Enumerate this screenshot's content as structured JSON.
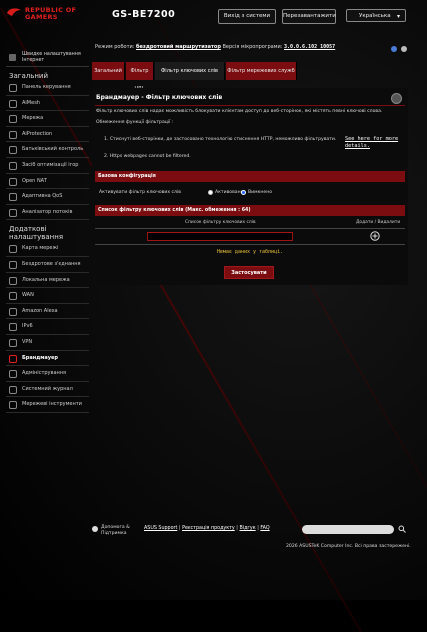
{
  "header": {
    "brand_line1": "REPUBLIC OF",
    "brand_line2": "GAMERS",
    "model": "GS-BE7200",
    "logout_label": "Вихід з системи",
    "reboot_label": "Перезавантажити",
    "language": "Українська"
  },
  "fwinfo": {
    "mode_label": "Режим роботи:",
    "mode_value": "бездротовий маршрутизатор",
    "version_label": "Версія мікропрограми:",
    "version_value": "3.0.0.6.102_10057"
  },
  "sidebar": {
    "quick_setup": "Швидке налаштування Інтернет",
    "general_title": "Загальний",
    "general_items": [
      {
        "label": "Панель керування",
        "icon": "dashboard-icon"
      },
      {
        "label": "AiMesh",
        "icon": "aimesh-icon"
      },
      {
        "label": "Мережа",
        "icon": "network-icon"
      },
      {
        "label": "AiProtection",
        "icon": "shield-icon"
      },
      {
        "label": "Батьківський контроль",
        "icon": "parental-icon"
      },
      {
        "label": "Засіб оптимізації ігор",
        "icon": "gamepad-icon"
      },
      {
        "label": "Open NAT",
        "icon": "nat-icon"
      },
      {
        "label": "Адаптивна QoS",
        "icon": "qos-icon"
      },
      {
        "label": "Аналізатор потоків",
        "icon": "traffic-icon"
      }
    ],
    "advanced_title": "Додаткові налаштування",
    "advanced_items": [
      {
        "label": "Карта мережі",
        "icon": "map-icon"
      },
      {
        "label": "Бездротове з'єднання",
        "icon": "wifi-icon"
      },
      {
        "label": "Локальна мережа",
        "icon": "lan-icon"
      },
      {
        "label": "WAN",
        "icon": "globe-icon"
      },
      {
        "label": "Amazon Alexa",
        "icon": "alexa-icon"
      },
      {
        "label": "IPv6",
        "icon": "ipv6-icon"
      },
      {
        "label": "VPN",
        "icon": "vpn-icon"
      },
      {
        "label": "Брандмауер",
        "icon": "firewall-icon",
        "active": true
      },
      {
        "label": "Адміністрування",
        "icon": "admin-icon"
      },
      {
        "label": "Системний журнал",
        "icon": "log-icon"
      },
      {
        "label": "Мережеві інструменти",
        "icon": "tools-icon"
      }
    ]
  },
  "tabs": [
    {
      "label": "Загальний"
    },
    {
      "label": "Фільтр URL"
    },
    {
      "label": "Фільтр ключових слів",
      "active": true
    },
    {
      "label": "Фільтр мережевих служб"
    }
  ],
  "panel": {
    "title": "Брандмауер - Фільтр ключових слів",
    "description": "Фільтр ключових слів надає можливість блокувати клієнтам доступ до веб-сторінок, які містять певні ключові слова.",
    "limits_title": "Обмеження функції фільтрації :",
    "limit1_text": "1. Стиснуті веб-сторінки, де застосовано технологію стиснення HTTP, неможливо фільтрувати.",
    "see_here": "See here for more details.",
    "limit2_text": "2. Https webpages cannot be filtered.",
    "basic_config": "Базова конфігурація",
    "enable_label": "Активувати фільтр ключових слів",
    "radio_on": "Активовано",
    "radio_off": "Вимкнено",
    "radio_selected": "off",
    "list_header": "Список фільтру ключових слів (Макс. обмеження : 64)",
    "col_keyword": "Список фільтру ключових слів",
    "col_action": "Додати / Видалити",
    "keyword_value": "",
    "empty_text": "Немає даних у таблиці.",
    "apply_label": "Застосувати"
  },
  "footer": {
    "help_label": "Допомога & Підтримка",
    "link_support": "ASUS Support",
    "link_registration": "Реєстрація продукту",
    "link_feedback": "Відгук",
    "link_faq": "FAQ",
    "sep": "|",
    "copyright": "2026 ASUSTeK Computer Inc. Всі права застережені."
  }
}
